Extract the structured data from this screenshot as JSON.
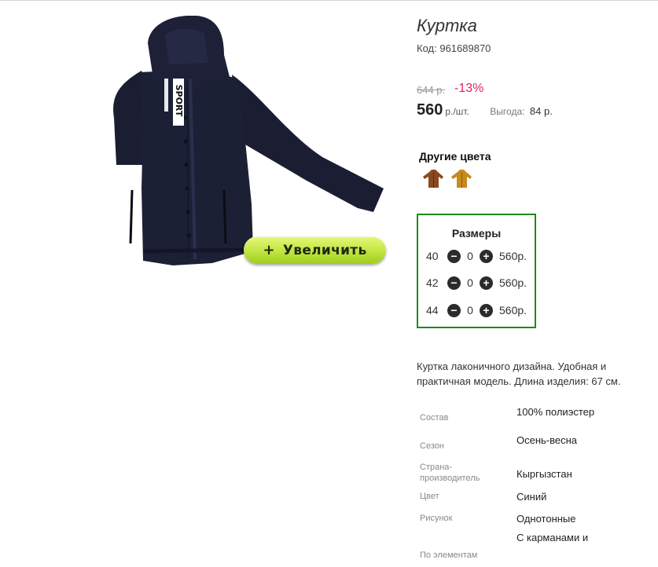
{
  "product": {
    "title": "Куртка",
    "code_label": "Код:",
    "code": "961689870",
    "old_price": "644 р.",
    "discount": "-13%",
    "price": "560",
    "price_unit": "р./шт.",
    "savings_label": "Выгода:",
    "savings_value": "84 р.",
    "image_text": "SPORT"
  },
  "zoom_button": {
    "label": "Увеличить",
    "icon": "+"
  },
  "other_colors": {
    "title": "Другие цвета",
    "swatches": [
      {
        "name": "brown-jacket",
        "color": "#8b4a1e"
      },
      {
        "name": "mustard-jacket",
        "color": "#c88a1c"
      }
    ]
  },
  "sizes": {
    "title": "Размеры",
    "rows": [
      {
        "size": "40",
        "qty": "0",
        "price": "560р."
      },
      {
        "size": "42",
        "qty": "0",
        "price": "560р."
      },
      {
        "size": "44",
        "qty": "0",
        "price": "560р."
      }
    ]
  },
  "description": "Куртка лаконичного дизайна. Удобная и практичная модель. Длина изделия: 67 см.",
  "specs": [
    {
      "label": "Состав",
      "value": "100% полиэстер"
    },
    {
      "label": "Сезон",
      "value": "Осень-весна"
    },
    {
      "label": "Страна-производитель",
      "value": "Кыргызстан"
    },
    {
      "label": "Цвет",
      "value": "Синий"
    },
    {
      "label": "Рисунок",
      "value": "Однотонные"
    },
    {
      "label": "По элементам",
      "value": "С карманами и"
    }
  ],
  "colors": {
    "accent_green": "#9fce1d",
    "discount_red": "#e0245e",
    "sizes_border": "#1d8b1d",
    "jacket_navy": "#1b1e33"
  }
}
